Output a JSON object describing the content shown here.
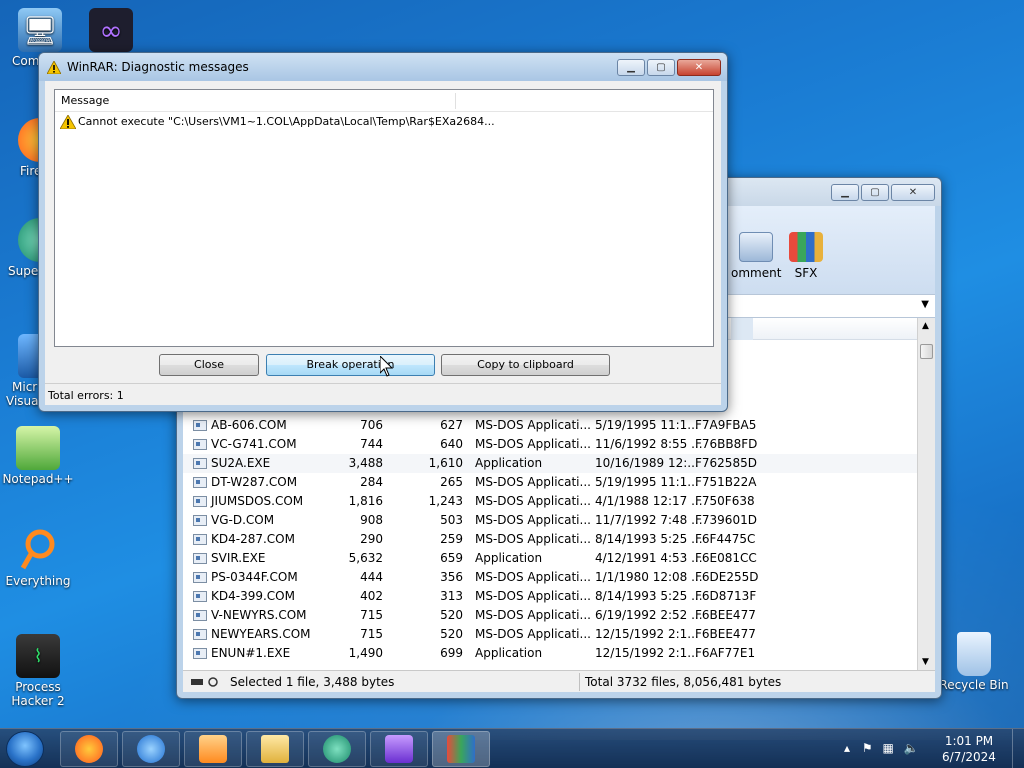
{
  "desktop": {
    "icons": [
      {
        "label": "Com"
      },
      {
        "label": "Fire"
      },
      {
        "label": "Super"
      },
      {
        "label": "Micr"
      },
      {
        "label": "Visual"
      },
      {
        "label": "Notepad++"
      },
      {
        "label": "Everything"
      },
      {
        "label": "Process Hacker 2"
      },
      {
        "label": "Recycle Bin"
      }
    ]
  },
  "diagnostic": {
    "title": "WinRAR: Diagnostic messages",
    "column_header": "Message",
    "messages": [
      {
        "text": "Cannot execute \"C:\\Users\\VM1~1.COL\\AppData\\Local\\Temp\\Rar$EXa2684..."
      }
    ],
    "buttons": {
      "close": "Close",
      "break": "Break operation",
      "copy": "Copy to clipboard"
    },
    "status": "Total errors: 1"
  },
  "winrar_main": {
    "toolbar": {
      "comment": "omment",
      "sfx": "SFX"
    },
    "files": [
      {
        "name": "",
        "size": "",
        "packed": "",
        "type": "",
        "modified": "",
        "crc": "72"
      },
      {
        "name": "",
        "size": "",
        "packed": "",
        "type": "",
        "modified": "",
        "crc": "05"
      },
      {
        "name": "",
        "size": "",
        "packed": "",
        "type": "",
        "modified": "",
        "crc": "D3"
      },
      {
        "name": "",
        "size": "",
        "packed": "",
        "type": "",
        "modified": "",
        "crc": "3D"
      },
      {
        "name": "AB-606.COM",
        "size": "706",
        "packed": "627",
        "type": "MS-DOS Applicati...",
        "modified": "5/19/1995 11:1...",
        "crc": "F7A9FBA5"
      },
      {
        "name": "VC-G741.COM",
        "size": "744",
        "packed": "640",
        "type": "MS-DOS Applicati...",
        "modified": "11/6/1992 8:55 ...",
        "crc": "F76BB8FD"
      },
      {
        "name": "SU2A.EXE",
        "size": "3,488",
        "packed": "1,610",
        "type": "Application",
        "modified": "10/16/1989 12:...",
        "crc": "F762585D"
      },
      {
        "name": "DT-W287.COM",
        "size": "284",
        "packed": "265",
        "type": "MS-DOS Applicati...",
        "modified": "5/19/1995 11:1...",
        "crc": "F751B22A"
      },
      {
        "name": "JIUMSDOS.COM",
        "size": "1,816",
        "packed": "1,243",
        "type": "MS-DOS Applicati...",
        "modified": "4/1/1988 12:17 ...",
        "crc": "F750F638"
      },
      {
        "name": "VG-D.COM",
        "size": "908",
        "packed": "503",
        "type": "MS-DOS Applicati...",
        "modified": "11/7/1992 7:48 ...",
        "crc": "F739601D"
      },
      {
        "name": "KD4-287.COM",
        "size": "290",
        "packed": "259",
        "type": "MS-DOS Applicati...",
        "modified": "8/14/1993 5:25 ...",
        "crc": "F6F4475C"
      },
      {
        "name": "SVIR.EXE",
        "size": "5,632",
        "packed": "659",
        "type": "Application",
        "modified": "4/12/1991 4:53 ...",
        "crc": "F6E081CC"
      },
      {
        "name": "PS-0344F.COM",
        "size": "444",
        "packed": "356",
        "type": "MS-DOS Applicati...",
        "modified": "1/1/1980 12:08 ...",
        "crc": "F6DE255D"
      },
      {
        "name": "KD4-399.COM",
        "size": "402",
        "packed": "313",
        "type": "MS-DOS Applicati...",
        "modified": "8/14/1993 5:25 ...",
        "crc": "F6D8713F"
      },
      {
        "name": "V-NEWYRS.COM",
        "size": "715",
        "packed": "520",
        "type": "MS-DOS Applicati...",
        "modified": "6/19/1992 2:52 ...",
        "crc": "F6BEE477"
      },
      {
        "name": "NEWYEARS.COM",
        "size": "715",
        "packed": "520",
        "type": "MS-DOS Applicati...",
        "modified": "12/15/1992 2:1...",
        "crc": "F6BEE477"
      },
      {
        "name": "ENUN#1.EXE",
        "size": "1,490",
        "packed": "699",
        "type": "Application",
        "modified": "12/15/1992 2:1...",
        "crc": "F6AF77E1"
      }
    ],
    "status_left": "Selected 1 file, 3,488 bytes",
    "status_right": "Total 3732 files, 8,056,481 bytes"
  },
  "taskbar": {
    "time": "1:01 PM",
    "date": "6/7/2024"
  },
  "colors": {
    "accent": "#3c7fb1",
    "desktop": "#1a7ad1"
  }
}
